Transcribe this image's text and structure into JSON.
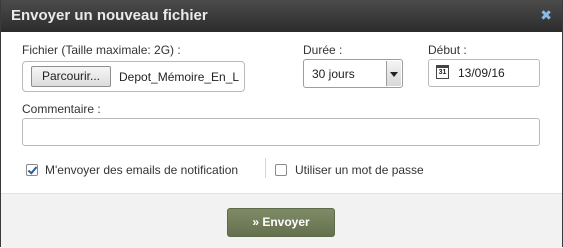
{
  "dialog": {
    "title": "Envoyer un nouveau fichier",
    "close_glyph": "✖"
  },
  "form": {
    "file_label": "Fichier (Taille maximale: 2G) :",
    "browse_label": "Parcourir...",
    "file_name": "Depot_Mémoire_En_L",
    "duration_label": "Durée :",
    "duration_value": "30 jours",
    "start_label": "Début :",
    "calendar_icon_text": "31",
    "start_value": "13/09/16",
    "comment_label": "Commentaire :",
    "comment_value": "",
    "notify_label": "M'envoyer des emails de notification",
    "notify_checked": true,
    "password_label": "Utiliser un mot de passe",
    "password_checked": false
  },
  "footer": {
    "send_label": "» Envoyer"
  },
  "colors": {
    "titlebar": "#2c2c2c",
    "close_icon": "#8ab9e6",
    "send_button": "#6f7a56"
  },
  "icons": [
    "close-icon",
    "calendar-icon",
    "dropdown-arrow-icon",
    "checkbox-checked-icon"
  ]
}
